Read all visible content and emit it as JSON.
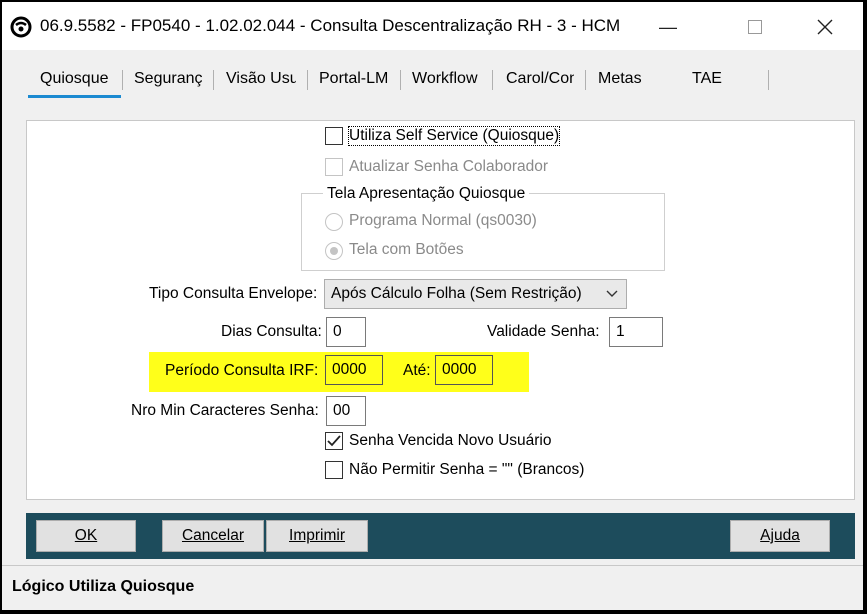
{
  "window": {
    "title": "06.9.5582 - FP0540 - 1.02.02.044 - Consulta Descentralização RH - 3 - HCM",
    "minimize": "—",
    "maximize": "☐",
    "close": "✕"
  },
  "tabs": [
    {
      "label": "Quiosque",
      "active": true
    },
    {
      "label": "Segurança"
    },
    {
      "label": "Visão Usuário"
    },
    {
      "label": "Portal-LM"
    },
    {
      "label": "Workflow"
    },
    {
      "label": "Carol/Contas"
    },
    {
      "label": "Metas"
    },
    {
      "label": "TAE"
    }
  ],
  "form": {
    "utiliza_self_service": {
      "label": "Utiliza Self Service (Quiosque)",
      "checked": false
    },
    "atualizar_senha": {
      "label": "Atualizar Senha Colaborador",
      "checked": false,
      "disabled": true
    },
    "tela_group": {
      "title": "Tela Apresentação Quiosque",
      "options": [
        {
          "label": "Programa Normal (qs0030)",
          "selected": false
        },
        {
          "label": "Tela com Botões",
          "selected": true
        }
      ]
    },
    "tipo_consulta": {
      "label": "Tipo Consulta Envelope:",
      "value": "Após Cálculo Folha (Sem Restrição)"
    },
    "dias_consulta": {
      "label": "Dias Consulta:",
      "value": "0"
    },
    "validade_senha": {
      "label": "Validade Senha:",
      "value": "1"
    },
    "periodo_irf": {
      "label": "Período Consulta IRF:",
      "value": "0000"
    },
    "ate": {
      "label": "Até:",
      "value": "0000"
    },
    "nro_min_caracteres": {
      "label": "Nro Min Caracteres Senha:",
      "value": "00"
    },
    "senha_vencida": {
      "label": "Senha Vencida Novo Usuário",
      "checked": true
    },
    "nao_permitir_brancos": {
      "label": "Não Permitir Senha = \"\" (Brancos)",
      "checked": false
    }
  },
  "buttons": {
    "ok": "OK",
    "cancelar": "Cancelar",
    "imprimir": "Imprimir",
    "ajuda": "Ajuda"
  },
  "status": {
    "text": "Lógico Utiliza Quiosque"
  },
  "colors": {
    "highlight": "#ffff1a",
    "button_bar": "#1d4c5c",
    "tab_accent": "#1b8ad1"
  }
}
